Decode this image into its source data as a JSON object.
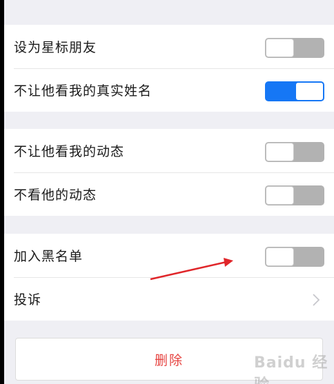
{
  "settings": {
    "group1": [
      {
        "label": "设为星标朋友",
        "toggle": "off"
      },
      {
        "label": "不让他看我的真实姓名",
        "toggle": "on"
      }
    ],
    "group2": [
      {
        "label": "不让他看我的动态",
        "toggle": "off"
      },
      {
        "label": "不看他的动态",
        "toggle": "off"
      }
    ],
    "group3": [
      {
        "label": "加入黑名单",
        "toggle": "off"
      },
      {
        "label": "投诉",
        "icon": "chevron-right-icon"
      }
    ]
  },
  "delete_button": {
    "label": "删除"
  },
  "watermark": {
    "text": "Baidu 经验"
  },
  "colors": {
    "toggle_on": "#1677f5",
    "toggle_off": "#b2b2b2",
    "delete_text": "#e64340",
    "annotation_arrow": "#e0262a"
  }
}
